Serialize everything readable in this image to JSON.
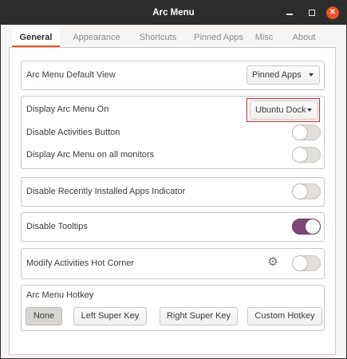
{
  "window": {
    "title": "Arc Menu",
    "close_glyph": "✕"
  },
  "tabs": [
    {
      "label": "General",
      "active": true
    },
    {
      "label": "Appearance",
      "active": false
    },
    {
      "label": "Shortcuts",
      "active": false
    },
    {
      "label": "Pinned Apps",
      "active": false
    },
    {
      "label": "Misc",
      "active": false
    },
    {
      "label": "About",
      "active": false
    }
  ],
  "general": {
    "default_view": {
      "label": "Arc Menu Default View",
      "value": "Pinned Apps"
    },
    "display_on": {
      "label": "Display Arc Menu On",
      "value": "Ubuntu Dock",
      "highlighted": true
    },
    "disable_activities": {
      "label": "Disable Activities Button",
      "on": false
    },
    "all_monitors": {
      "label": "Display Arc Menu on all monitors",
      "on": false
    },
    "recently_installed": {
      "label": "Disable Recently Installed Apps Indicator",
      "on": false
    },
    "tooltips": {
      "label": "Disable Tooltips",
      "on": true
    },
    "hot_corner": {
      "label": "Modify Activities Hot Corner",
      "on": false,
      "settings_icon": "gear-icon",
      "settings_glyph": "⚙"
    },
    "hotkey": {
      "label": "Arc Menu Hotkey",
      "options": [
        "None",
        "Left Super Key",
        "Right Super Key",
        "Custom Hotkey"
      ],
      "selected": "None"
    }
  },
  "colors": {
    "accent": "#e95420",
    "switch_on": "#7f4678",
    "highlight": "#e0262a",
    "titlebar": "#2c2c2c"
  }
}
